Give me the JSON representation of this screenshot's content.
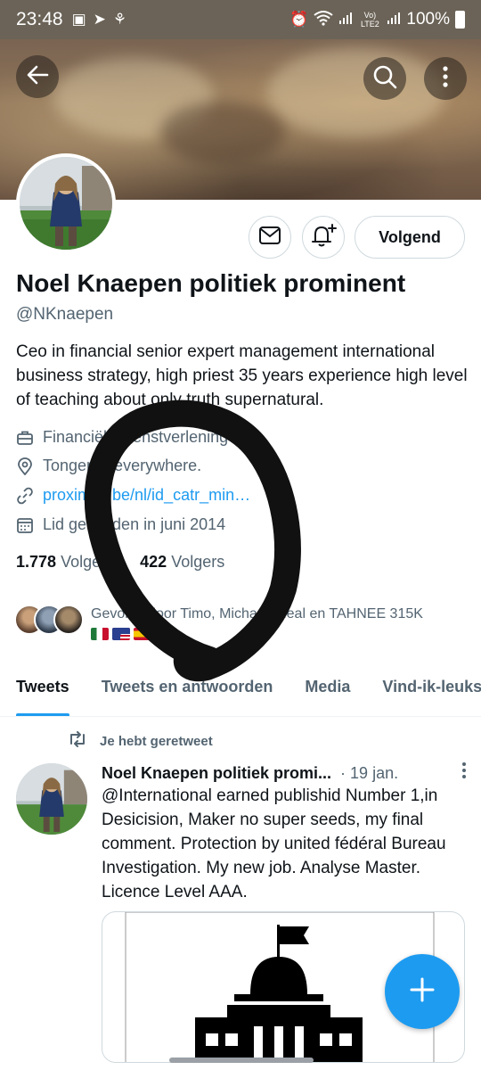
{
  "status_bar": {
    "time": "23:48",
    "network": "Vo) LTE2",
    "battery": "100%"
  },
  "header": {
    "back_icon": "arrow-left-icon",
    "search_icon": "search-icon",
    "more_icon": "more-vertical-icon"
  },
  "profile": {
    "name": "Noel Knaepen politiek prominent",
    "handle": "@NKnaepen",
    "bio": "Ceo in financial senior expert management international business strategy, high priest 35 years experience high level of teaching about only truth supernatural.",
    "category": "Financiële dienstverlening",
    "location": "Tongeren everywhere.",
    "website": "proximus.be/nl/id_catr_min…",
    "joined": "Lid geworden in juni 2014",
    "following_count": "1.778",
    "following_label": "Volgend",
    "followers_count": "422",
    "followers_label": "Volgers",
    "followed_by": "Gevolgd door Timo, Michael, Neal en TAHNEE 315K",
    "follow_button": "Volgend"
  },
  "tabs": [
    {
      "label": "Tweets",
      "active": true
    },
    {
      "label": "Tweets en antwoorden",
      "active": false
    },
    {
      "label": "Media",
      "active": false
    },
    {
      "label": "Vind-ik-leuks",
      "active": false
    }
  ],
  "tweet": {
    "retweet_label": "Je hebt geretweet",
    "author": "Noel Knaepen politiek promi...",
    "date": "· 19 jan.",
    "text": "@International earned publishid Number 1,in Desicision, Maker no super seeds, my final comment. Protection by united fédéral Bureau Investigation. My new job. Analyse Master. Licence Level AAA."
  },
  "colors": {
    "accent": "#1d9bf0",
    "text": "#0f1419",
    "secondary": "#536471",
    "status_bar": "#6b6357"
  }
}
